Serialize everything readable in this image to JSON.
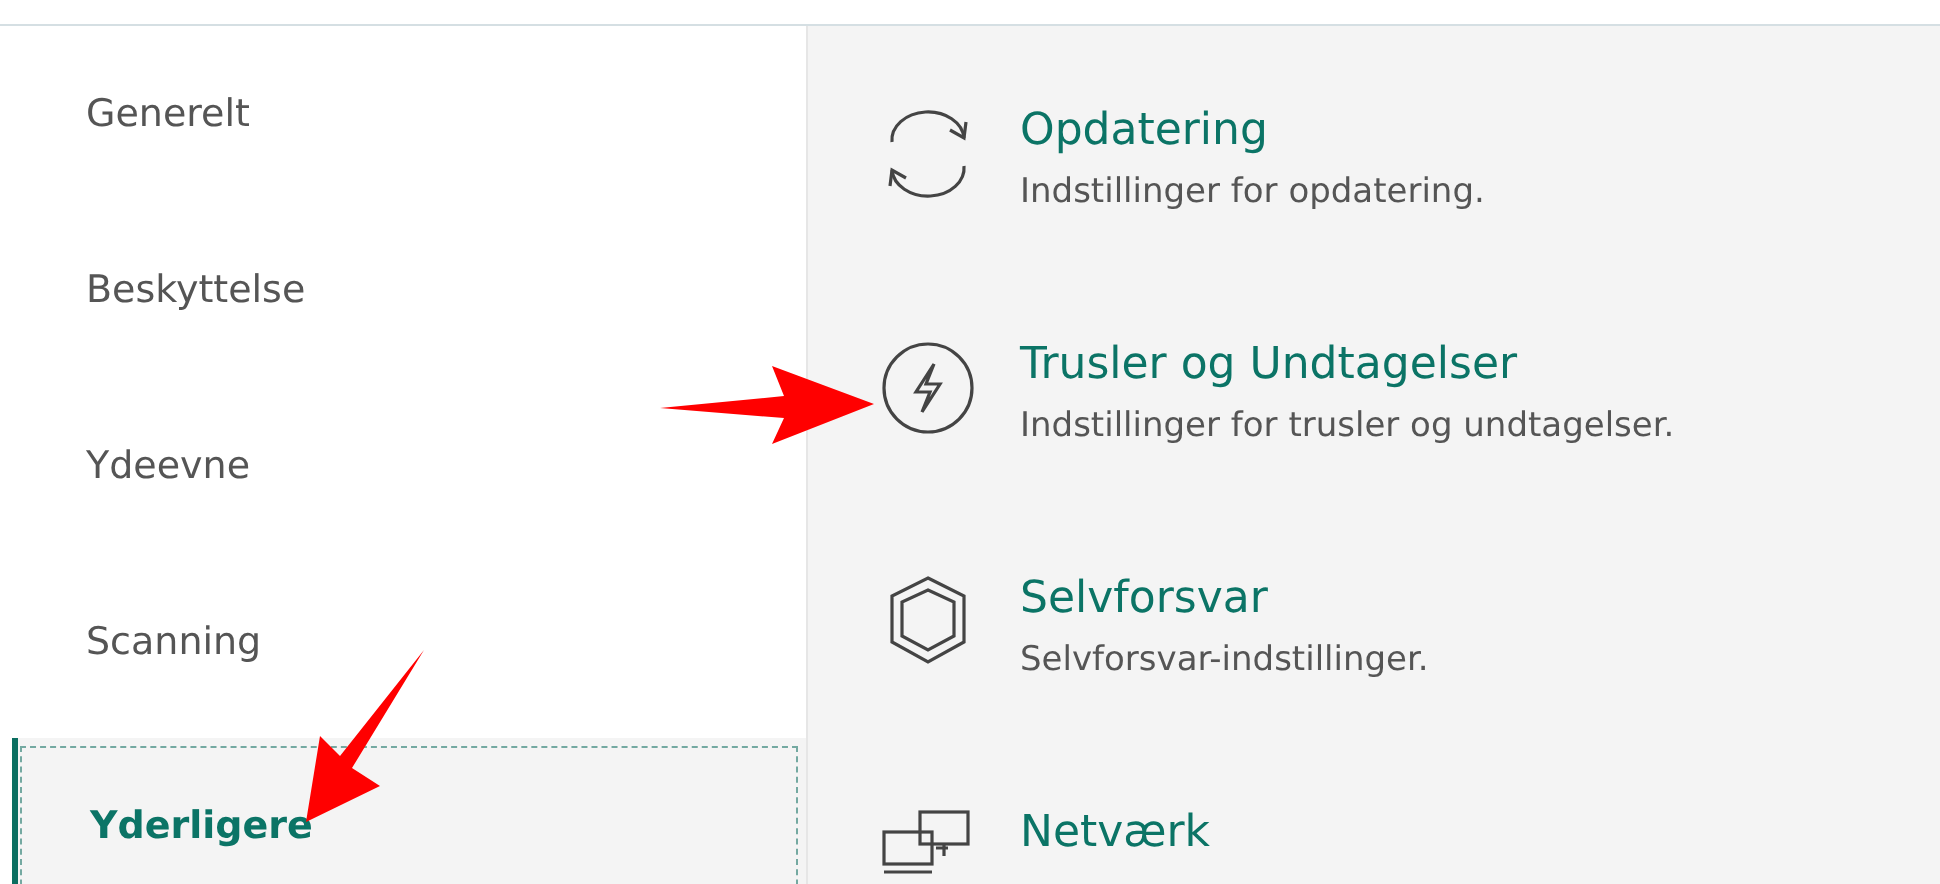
{
  "sidebar": {
    "items": [
      {
        "label": "Generelt",
        "selected": false
      },
      {
        "label": "Beskyttelse",
        "selected": false
      },
      {
        "label": "Ydeevne",
        "selected": false
      },
      {
        "label": "Scanning",
        "selected": false
      },
      {
        "label": "Yderligere",
        "selected": true
      }
    ]
  },
  "settings": [
    {
      "kind": "update",
      "title": "Opdatering",
      "description": "Indstillinger for opdatering."
    },
    {
      "kind": "threats",
      "title": "Trusler og Undtagelser",
      "description": "Indstillinger for trusler og undtagelser."
    },
    {
      "kind": "shield",
      "title": "Selvforsvar",
      "description": "Selvforsvar-indstillinger."
    },
    {
      "kind": "network",
      "title": "Netværk"
    }
  ]
}
